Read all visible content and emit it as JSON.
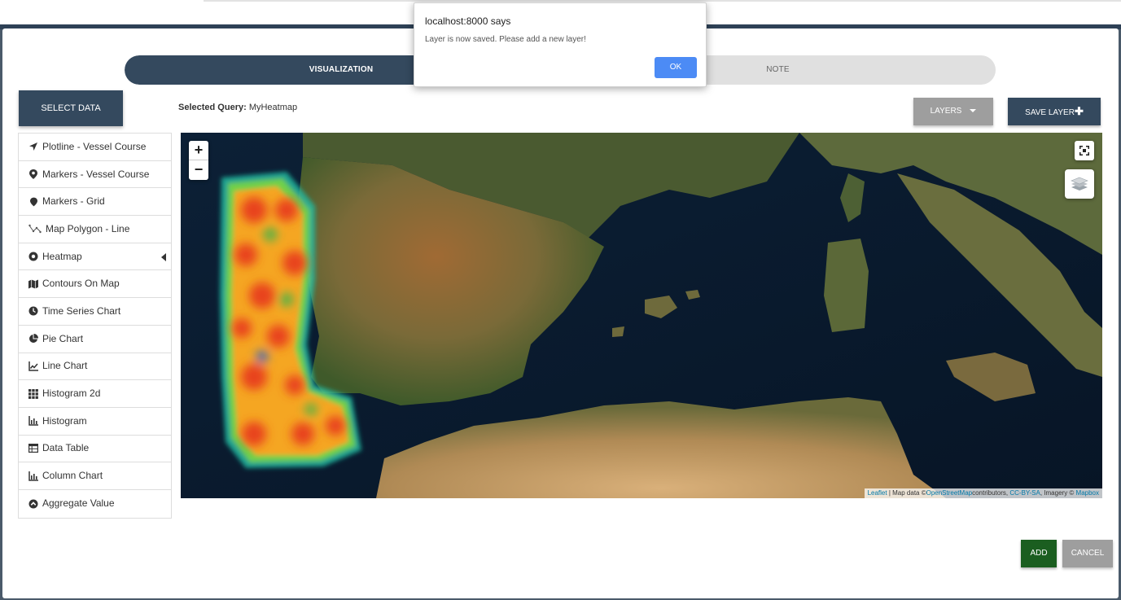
{
  "alert": {
    "title": "localhost:8000 says",
    "message": "Layer is now saved. Please add a new layer!",
    "ok_label": "OK"
  },
  "tabs": [
    {
      "label": "VISUALIZATION",
      "active": true
    },
    {
      "label": "NOTE",
      "active": false
    }
  ],
  "toolbar": {
    "select_data_label": "SELECT DATA",
    "selected_query_label": "Selected Query:",
    "selected_query_value": "MyHeatmap",
    "layers_label": "LAYERS",
    "save_layer_label": "SAVE LAYER"
  },
  "visualizations": [
    {
      "label": "Plotline - Vessel Course",
      "icon": "location-arrow-icon"
    },
    {
      "label": "Markers - Vessel Course",
      "icon": "map-marker-icon"
    },
    {
      "label": "Markers - Grid",
      "icon": "map-marker-icon"
    },
    {
      "label": "Map Polygon - Line",
      "icon": "polygon-icon"
    },
    {
      "label": "Heatmap",
      "icon": "circle-dot-icon",
      "selected": true
    },
    {
      "label": "Contours On Map",
      "icon": "map-icon"
    },
    {
      "label": "Time Series Chart",
      "icon": "clock-icon"
    },
    {
      "label": "Pie Chart",
      "icon": "pie-chart-icon"
    },
    {
      "label": "Line Chart",
      "icon": "line-chart-icon"
    },
    {
      "label": "Histogram 2d",
      "icon": "grid-icon"
    },
    {
      "label": "Histogram",
      "icon": "bar-chart-icon"
    },
    {
      "label": "Data Table",
      "icon": "table-icon"
    },
    {
      "label": "Column Chart",
      "icon": "bar-chart-icon"
    },
    {
      "label": "Aggregate Value",
      "icon": "arrow-circle-up-icon"
    }
  ],
  "map": {
    "zoom_in": "+",
    "zoom_out": "−",
    "attribution": {
      "leaflet": "Leaflet",
      "sep": " | Map data ©",
      "osm": "OpenStreetMap",
      "contributors": "contributors, ",
      "license": "CC-BY-SA",
      "imagery": ", Imagery © ",
      "mapbox": "Mapbox"
    }
  },
  "footer": {
    "add_label": "ADD",
    "cancel_label": "CANCEL"
  },
  "colors": {
    "primary": "#34495e",
    "add": "#1b5e20",
    "neutral": "#9e9e9e",
    "alert_button": "#4c8bf5"
  }
}
